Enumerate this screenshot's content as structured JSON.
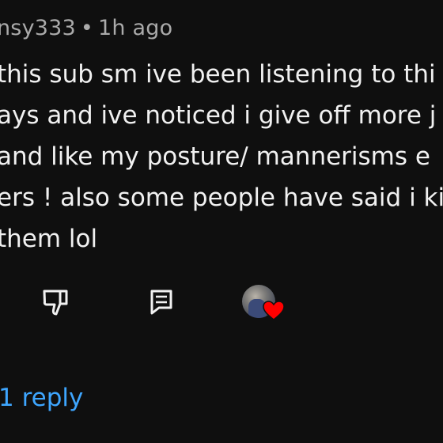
{
  "comment": {
    "author": "nsy333",
    "separator": "•",
    "time": "1h ago",
    "lines": [
      "this sub sm ive been listening to thi",
      "ays and ive noticed i give off more j",
      "and like my posture/ mannerisms e",
      "ers ! also some people have said i ki",
      "them lol"
    ]
  },
  "actions": {
    "dislike_icon": "thumbs-down-icon",
    "reply_icon": "comment-reply-icon",
    "creator_heart_icon": "creator-heart-icon"
  },
  "replies": {
    "label": "1 reply"
  },
  "colors": {
    "background": "#0f0f0f",
    "text": "#f1f1f1",
    "meta": "#aaaaaa",
    "link": "#3ea6ff",
    "heart": "#ff0000"
  }
}
